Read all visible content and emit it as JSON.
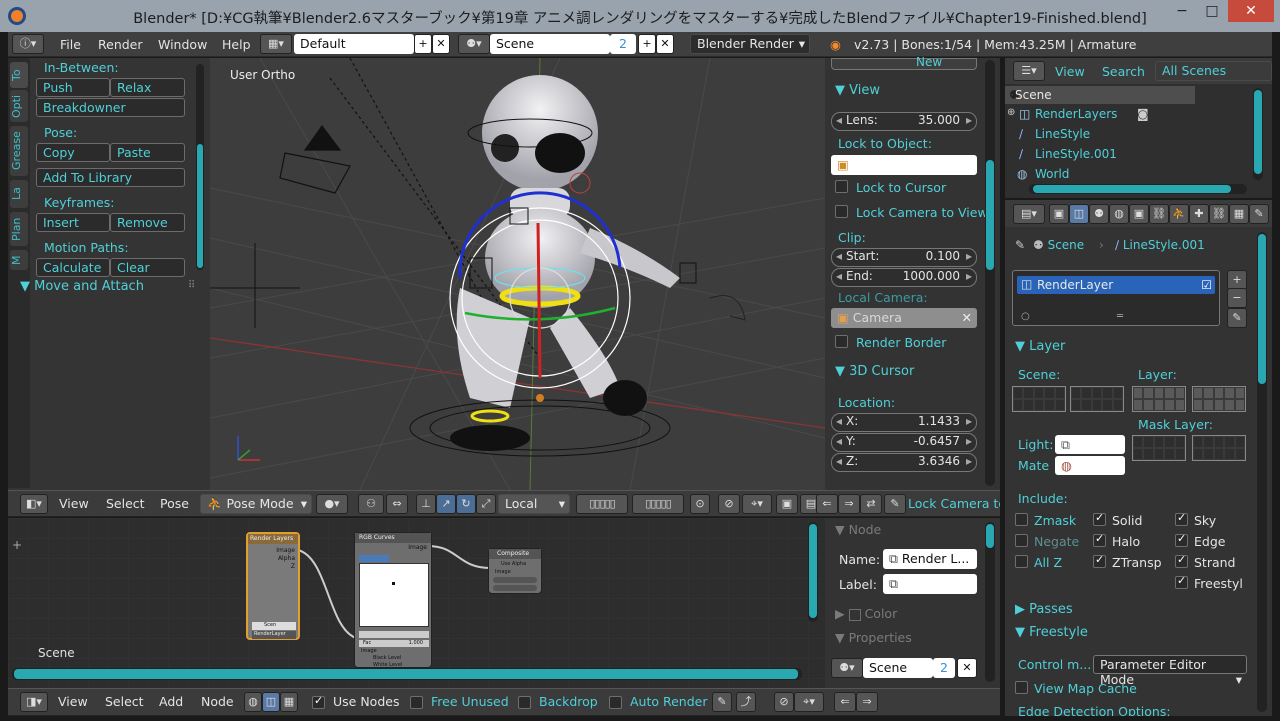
{
  "window": {
    "title": "Blender* [D:¥CG執筆¥Blender2.6マスターブック¥第19章 アニメ調レンダリングをマスターする¥完成したBlendファイル¥Chapter19-Finished.blend]",
    "minimize": "−",
    "maximize": "□",
    "close": "✕"
  },
  "info_header": {
    "menus": [
      "File",
      "Render",
      "Window",
      "Help"
    ],
    "layout": "Default",
    "scene": "Scene",
    "scene_users": "2",
    "engine": "Blender Render",
    "stats": "v2.73 | Bones:1/54 | Mem:43.25M | Armature"
  },
  "toolshelf": {
    "tabs": [
      "To",
      "Opti",
      "Grease",
      "La",
      "Plan",
      "M"
    ],
    "inbetween_label": "In-Between:",
    "push": "Push",
    "relax": "Relax",
    "breakdowner": "Breakdowner",
    "pose_label": "Pose:",
    "copy": "Copy",
    "paste": "Paste",
    "add_to_library": "Add To Library",
    "keyframes_label": "Keyframes:",
    "insert": "Insert",
    "remove": "Remove",
    "motion_paths_label": "Motion Paths:",
    "calculate": "Calculate",
    "clear": "Clear",
    "move_attach": "Move and Attach"
  },
  "viewport": {
    "label": "User Ortho"
  },
  "npanel": {
    "new": "New",
    "view_header": "View",
    "lens_label": "Lens:",
    "lens_value": "35.000",
    "lock_to_object": "Lock to Object:",
    "lock_to_cursor": "Lock to Cursor",
    "lock_camera_to_view": "Lock Camera to View",
    "clip_label": "Clip:",
    "start_label": "Start:",
    "start_value": "0.100",
    "end_label": "End:",
    "end_value": "1000.000",
    "local_camera": "Local Camera:",
    "camera": "Camera",
    "render_border": "Render Border",
    "cursor_header": "3D Cursor",
    "location_label": "Location:",
    "x_label": "X:",
    "x_value": "1.1433",
    "y_label": "Y:",
    "y_value": "-0.6457",
    "z_label": "Z:",
    "z_value": "3.6346"
  },
  "view3d_header": {
    "menus": [
      "View",
      "Select",
      "Pose"
    ],
    "mode": "Pose Mode",
    "orientation": "Local",
    "lock_camera": "Lock Camera to V"
  },
  "outliner": {
    "view": "View",
    "search": "Search",
    "filter": "All Scenes",
    "items": [
      "Scene",
      "RenderLayers",
      "LineStyle",
      "LineStyle.001",
      "World"
    ]
  },
  "properties": {
    "breadcrumb_scene": "Scene",
    "breadcrumb_linestyle": "LineStyle.001",
    "render_layer": "RenderLayer",
    "layer_header": "Layer",
    "scene_label": "Scene:",
    "layer_label": "Layer:",
    "mask_layer_label": "Mask Layer:",
    "light_label": "Light:",
    "mate_label": "Mate",
    "include_label": "Include:",
    "include": [
      {
        "label": "Zmask",
        "checked": false
      },
      {
        "label": "Solid",
        "checked": true
      },
      {
        "label": "Sky",
        "checked": true
      },
      {
        "label": "Negate",
        "checked": false
      },
      {
        "label": "Halo",
        "checked": true
      },
      {
        "label": "Edge",
        "checked": true
      },
      {
        "label": "All Z",
        "checked": false
      },
      {
        "label": "ZTransp",
        "checked": true
      },
      {
        "label": "Strand",
        "checked": true
      },
      {
        "label": "Freestyl",
        "checked": true
      }
    ],
    "passes": "Passes",
    "freestyle": "Freestyle",
    "control_mode_label": "Control m...",
    "control_mode_value": "Parameter Editor Mode",
    "view_map_cache": "View Map Cache",
    "edge_detection": "Edge Detection Options:"
  },
  "node_editor": {
    "scene_label": "Scene",
    "nodes": {
      "render_layers": {
        "title": "Render Layers",
        "outputs": [
          "Image",
          "Alpha",
          "Z"
        ],
        "scene": "Scen",
        "layer": "RenderLayer"
      },
      "rgb_curves": {
        "title": "RGB Curves",
        "output": "Image",
        "fac": "Fac",
        "fac_value": "1.000",
        "inputs": [
          "Image",
          "Black Level",
          "White Level"
        ]
      },
      "composite": {
        "title": "Composite",
        "use_alpha": "Use Alpha",
        "image": "Image"
      }
    }
  },
  "node_panel": {
    "node_header": "Node",
    "name_label": "Name:",
    "name_value": "Render L...",
    "label_label": "Label:",
    "color": "Color",
    "properties": "Properties",
    "scene": "Scene",
    "scene_users": "2"
  },
  "node_header": {
    "menus": [
      "View",
      "Select",
      "Add",
      "Node"
    ],
    "use_nodes": "Use Nodes",
    "free_unused": "Free Unused",
    "backdrop": "Backdrop",
    "auto_render": "Auto Render"
  }
}
